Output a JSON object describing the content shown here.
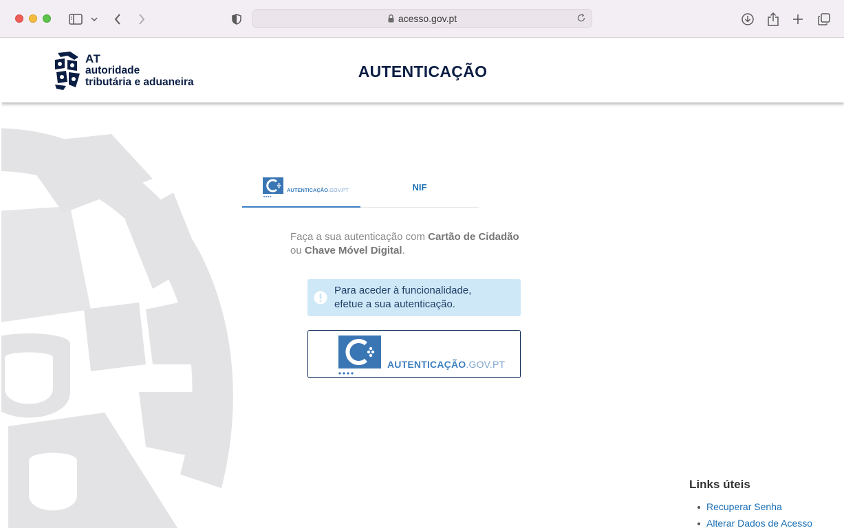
{
  "browser": {
    "url": "acesso.gov.pt"
  },
  "header": {
    "logo_short": "AT",
    "logo_line1": "autoridade",
    "logo_line2": "tributária e aduaneira",
    "title": "AUTENTICAÇÃO"
  },
  "tabs": {
    "auth_label_bold": "AUTENTICAÇÃO",
    "auth_label_rest": ".GOV.PT",
    "nif": "NIF"
  },
  "intro": {
    "part1": "Faça a sua autenticação com ",
    "bold1": "Cartão de Cidadão",
    "part2": "ou ",
    "bold2": "Chave Móvel Digital",
    "part3": "."
  },
  "alert": {
    "line1": "Para aceder à funcionalidade,",
    "line2": "efetue a sua autenticação."
  },
  "auth_button": {
    "label_bold": "AUTENTICAÇÃO",
    "label_rest": ".GOV.PT"
  },
  "links": {
    "title": "Links úteis",
    "items": [
      "Recuperar Senha",
      "Alterar Dados de Acesso"
    ]
  },
  "colors": {
    "brand_navy": "#0b1e44",
    "accent_blue": "#1a6fb5",
    "alert_bg": "#cfe8f8"
  }
}
